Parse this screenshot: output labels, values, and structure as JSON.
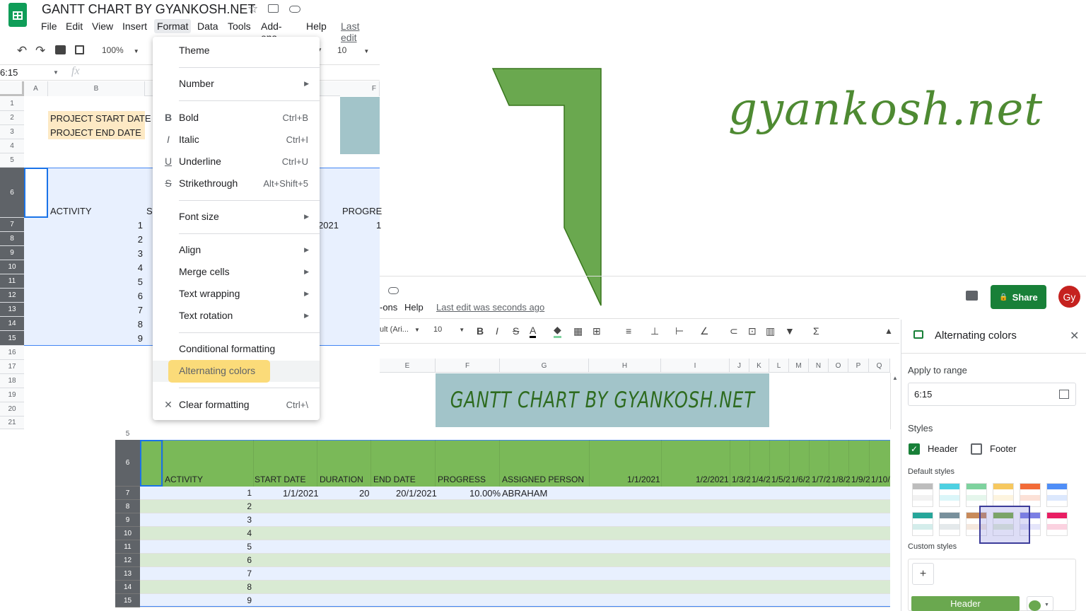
{
  "doc": {
    "title": "GANTT CHART BY GYANKOSH.NET",
    "last_edit_short": "Last edit"
  },
  "menubar": [
    "File",
    "Edit",
    "View",
    "Insert",
    "Format",
    "Data",
    "Tools",
    "Add-ons",
    "Help"
  ],
  "toolbar": {
    "zoom": "100%",
    "font_size": "10"
  },
  "namebox": {
    "value": "6:15",
    "fx": "fx"
  },
  "left_grid": {
    "cols": [
      "A",
      "B",
      "F"
    ],
    "rows": [
      "1",
      "2",
      "3",
      "4",
      "5",
      "6",
      "7",
      "8",
      "9",
      "10",
      "11",
      "12",
      "13",
      "14",
      "15",
      "16",
      "17",
      "18",
      "19",
      "20",
      "21"
    ],
    "start_label": "PROJECT START DATE",
    "end_label": "PROJECT END DATE",
    "activity": "ACTIVITY",
    "s_partial": "S",
    "progress_partial": "PROGRE",
    "date_partial": "2021",
    "prog_val_partial": "1",
    "nums": [
      "1",
      "2",
      "3",
      "4",
      "5",
      "6",
      "7",
      "8",
      "9"
    ]
  },
  "format_menu": {
    "items": [
      {
        "label": "Theme"
      },
      {
        "label": "Number"
      },
      {
        "label": "Bold",
        "shortcut": "Ctrl+B",
        "icon": "B"
      },
      {
        "label": "Italic",
        "shortcut": "Ctrl+I",
        "icon": "I"
      },
      {
        "label": "Underline",
        "shortcut": "Ctrl+U",
        "icon": "U"
      },
      {
        "label": "Strikethrough",
        "shortcut": "Alt+Shift+5",
        "icon": "S"
      },
      {
        "label": "Font size"
      },
      {
        "label": "Align"
      },
      {
        "label": "Merge cells"
      },
      {
        "label": "Text wrapping"
      },
      {
        "label": "Text rotation"
      },
      {
        "label": "Conditional formatting"
      },
      {
        "label": "Alternating colors"
      },
      {
        "label": "Clear formatting",
        "shortcut": "Ctrl+\\"
      }
    ]
  },
  "logo": {
    "text": "gyankosh.net"
  },
  "second": {
    "menu_partial": "-ons",
    "help": "Help",
    "last_edit": "Last edit was seconds ago",
    "font_partial": "ult (Ari...",
    "font_size": "10",
    "share": "Share",
    "avatar": "Gy",
    "cols": [
      "E",
      "F",
      "G",
      "H",
      "I",
      "J",
      "K",
      "L",
      "M",
      "N",
      "O",
      "P",
      "Q"
    ],
    "banner": "GANTT CHART BY GYANKOSH.NET"
  },
  "panel": {
    "title": "Alternating colors",
    "apply_label": "Apply to range",
    "range": "6:15",
    "styles": "Styles",
    "header": "Header",
    "footer": "Footer",
    "default_styles": "Default styles",
    "custom_styles": "Custom styles",
    "add": "+",
    "header_btn": "Header",
    "swatch_colors": [
      "#bdbdbd",
      "#4dd0e1",
      "#7ed29e",
      "#f6c85f",
      "#f26b38",
      "#4f8ef7",
      "#26a69a",
      "#78909c",
      "#c88a5a",
      "#7cb342",
      "#7b7fe4",
      "#e91e63"
    ],
    "green": "#6aa84f"
  },
  "bottom_table": {
    "rows": [
      "5",
      "6",
      "7",
      "8",
      "9",
      "10",
      "11",
      "12",
      "13",
      "14",
      "15"
    ],
    "headers": [
      "ACTIVITY",
      "START DATE",
      "DURATION",
      "END DATE",
      "PROGRESS",
      "ASSIGNED PERSON",
      "1/1/2021",
      "1/2/2021",
      "1/3/2",
      "1/4/2",
      "1/5/2",
      "1/6/2",
      "1/7/2",
      "1/8/2",
      "1/9/2",
      "1/10/"
    ],
    "first_row": {
      "start": "1/1/2021",
      "duration": "20",
      "end": "20/1/2021",
      "progress": "10.00%",
      "person": "ABRAHAM"
    },
    "nums": [
      "1",
      "2",
      "3",
      "4",
      "5",
      "6",
      "7",
      "8",
      "9"
    ]
  }
}
